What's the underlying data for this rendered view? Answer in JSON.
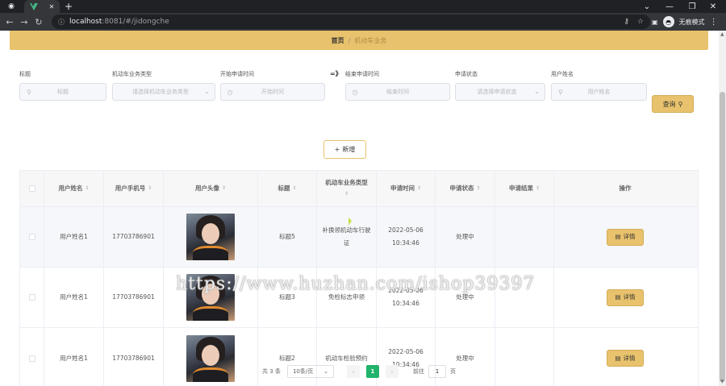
{
  "browser": {
    "tab_title": "V",
    "url_host": "localhost",
    "url_path": ":8081/#/jidongche",
    "incognito_label": "无痕模式"
  },
  "breadcrumb": {
    "home": "首页",
    "separator": "/",
    "current": "机动车业务"
  },
  "filters": {
    "title_label": "标题",
    "title_ph": "标题",
    "type_label": "机动车业务类型",
    "type_ph": "请选择机动车业务类型",
    "start_label": "开始申请时间",
    "start_ph": "开始时间",
    "arrow": "=》",
    "end_label": "结束申请时间",
    "end_ph": "结束时间",
    "status_label": "申请状态",
    "status_ph": "请选择申请状态",
    "user_label": "用户姓名",
    "user_ph": "用户姓名",
    "query_label": "查询"
  },
  "add_label": "新增",
  "table": {
    "columns": [
      "用户姓名",
      "用户手机号",
      "用户头像",
      "标题",
      "机动车业务类型",
      "申请时间",
      "申请状态",
      "申请结果",
      "操作"
    ],
    "rows": [
      {
        "name": "用户姓名1",
        "phone": "17703786901",
        "title": "标题5",
        "type": "补换领机动车行驶证",
        "time": "2022-05-06 10:34:46",
        "status": "处理中",
        "result": "",
        "action": "详情"
      },
      {
        "name": "用户姓名1",
        "phone": "17703786901",
        "title": "标题3",
        "type": "免检标志申领",
        "time": "2022-05-06 10:34:46",
        "status": "处理中",
        "result": "",
        "action": "详情"
      },
      {
        "name": "用户姓名1",
        "phone": "17703786901",
        "title": "标题2",
        "type": "机动车检验预约",
        "time": "2022-05-06 10:34:46",
        "status": "处理中",
        "result": "",
        "action": "详情"
      }
    ]
  },
  "pagination": {
    "total": "共 3 条",
    "page_size": "10条/页",
    "current_page": "1",
    "goto_prefix": "前往",
    "goto_value": "1",
    "goto_suffix": "页"
  },
  "watermark": "https://www.huzhan.com/ishop39397",
  "colors": {
    "accent": "#e8c26c",
    "pager_active": "#21b36b"
  }
}
